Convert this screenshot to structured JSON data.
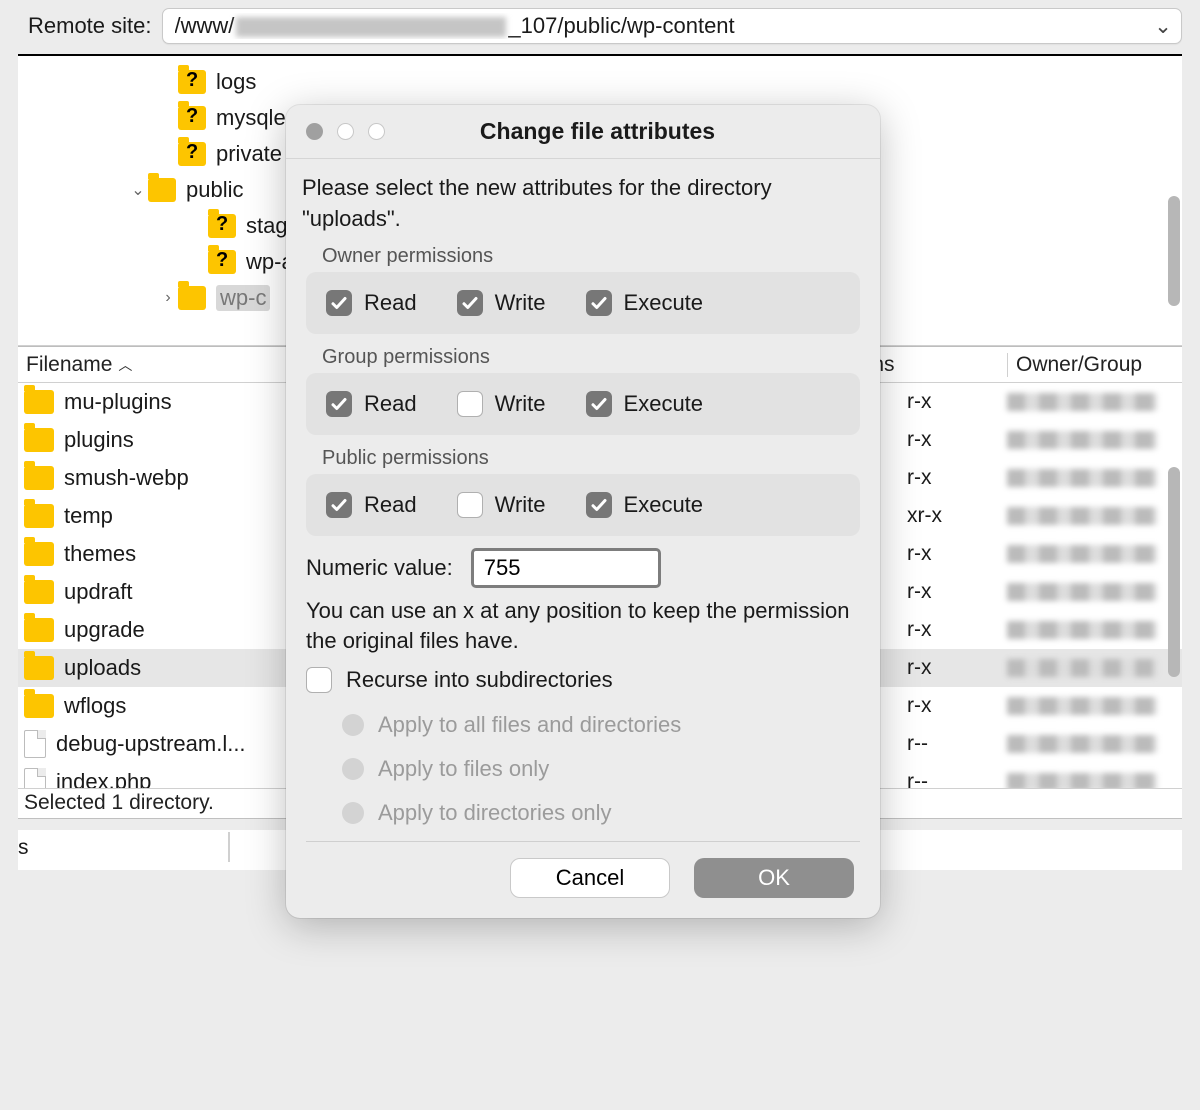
{
  "topbar": {
    "label": "Remote site:",
    "path_prefix": "/www/",
    "path_suffix": "_107/public/wp-content"
  },
  "tree": [
    {
      "indent": 140,
      "caret": "",
      "folder": "q",
      "name": "logs"
    },
    {
      "indent": 140,
      "caret": "",
      "folder": "q",
      "name": "mysqled"
    },
    {
      "indent": 140,
      "caret": "",
      "folder": "q",
      "name": "private"
    },
    {
      "indent": 110,
      "caret": "⌄",
      "folder": "p",
      "name": "public"
    },
    {
      "indent": 170,
      "caret": "",
      "folder": "q",
      "name": "stagi"
    },
    {
      "indent": 170,
      "caret": "",
      "folder": "q",
      "name": "wp-a"
    },
    {
      "indent": 140,
      "caret": "›",
      "folder": "p",
      "name": "wp-c",
      "sel": true
    },
    {
      "indent": 250,
      "caret": "",
      "folder": "",
      "name": "."
    }
  ],
  "list_headers": {
    "filename": "Filename",
    "permissions": "ions",
    "owner": "Owner/Group"
  },
  "files": [
    {
      "type": "fld",
      "name": "mu-plugins",
      "perm": "r-x",
      "sel": false
    },
    {
      "type": "fld",
      "name": "plugins",
      "perm": "r-x",
      "sel": false
    },
    {
      "type": "fld",
      "name": "smush-webp",
      "perm": "r-x",
      "sel": false
    },
    {
      "type": "fld",
      "name": "temp",
      "perm": "xr-x",
      "sel": false
    },
    {
      "type": "fld",
      "name": "themes",
      "perm": "r-x",
      "sel": false
    },
    {
      "type": "fld",
      "name": "updraft",
      "perm": "r-x",
      "sel": false
    },
    {
      "type": "fld",
      "name": "upgrade",
      "perm": "r-x",
      "sel": false
    },
    {
      "type": "fld",
      "name": "uploads",
      "perm": "r-x",
      "sel": true
    },
    {
      "type": "fld",
      "name": "wflogs",
      "perm": "r-x",
      "sel": false
    },
    {
      "type": "file",
      "name": "debug-upstream.l...",
      "perm": "r--",
      "sel": false
    },
    {
      "type": "file",
      "name": "index.php",
      "perm": "r--",
      "sel": false
    }
  ],
  "status_text": "Selected 1 directory.",
  "bottom_letter": "s",
  "dialog": {
    "title": "Change file attributes",
    "intro": "Please select the new attributes for the directory \"uploads\".",
    "groups": [
      {
        "label": "Owner permissions",
        "read": true,
        "write": true,
        "execute": true
      },
      {
        "label": "Group permissions",
        "read": true,
        "write": false,
        "execute": true
      },
      {
        "label": "Public permissions",
        "read": true,
        "write": false,
        "execute": true
      }
    ],
    "perm_labels": {
      "read": "Read",
      "write": "Write",
      "execute": "Execute"
    },
    "numeric_label": "Numeric value:",
    "numeric_value": "755",
    "hint": "You can use an x at any position to keep the permission the original files have.",
    "recurse": "Recurse into subdirectories",
    "radios": [
      "Apply to all files and directories",
      "Apply to files only",
      "Apply to directories only"
    ],
    "cancel": "Cancel",
    "ok": "OK"
  }
}
